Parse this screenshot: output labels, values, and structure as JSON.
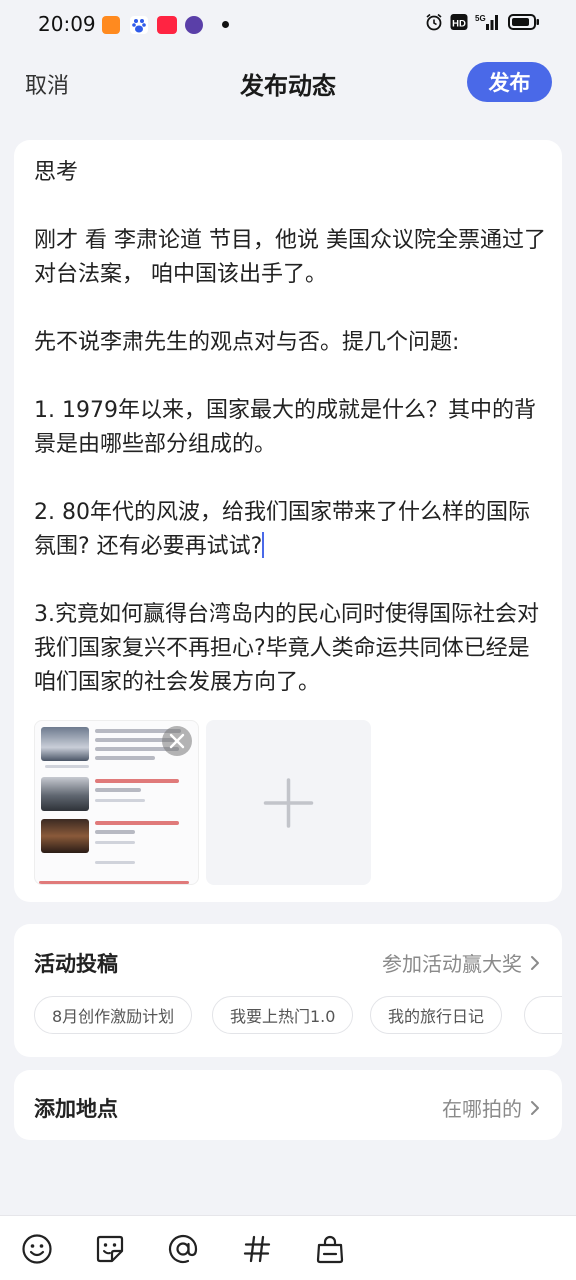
{
  "status_bar": {
    "time": "20:09",
    "app_icons": [
      "taobao-icon",
      "baidu-icon",
      "xiaohongshu-icon",
      "browser-icon"
    ],
    "indicators": [
      "alarm-icon",
      "hd-icon",
      "5g-signal-icon",
      "battery-icon"
    ],
    "hd_label": "HD",
    "network_label": "5G"
  },
  "header": {
    "cancel_label": "取消",
    "title": "发布动态",
    "publish_label": "发布"
  },
  "editor": {
    "text_before_caret": "思考\n\n刚才 看 李肃论道 节目，他说 美国众议院全票通过了对台法案， 咱中国该出手了。\n\n先不说李肃先生的观点对与否。提几个问题:\n\n1. 1979年以来，国家最大的成就是什么？其中的背景是由哪些部分组成的。\n\n2. 80年代的风波，给我们国家带来了什么样的国际氛围? 还有必要再试试?",
    "text_after_caret": "\n\n3.究竟如何赢得台湾岛内的民心同时使得国际社会对我们国家复兴不再担心?毕竟人类命运共同体已经是咱们国家的社会发展方向了。"
  },
  "media": {
    "thumbnail": "news-screenshot",
    "remove_icon": "close-icon",
    "add_icon": "plus-icon"
  },
  "activity": {
    "title": "活动投稿",
    "link_label": "参加活动赢大奖",
    "tags": [
      "8月创作激励计划",
      "我要上热门1.0",
      "我的旅行日记"
    ]
  },
  "location": {
    "title": "添加地点",
    "link_label": "在哪拍的"
  },
  "toolbar": {
    "icons": [
      "emoji-icon",
      "sticker-icon",
      "mention-icon",
      "hashtag-icon",
      "bag-icon"
    ]
  },
  "colors": {
    "accent": "#4a69e8",
    "background": "#f2f3f7",
    "card": "#ffffff"
  }
}
